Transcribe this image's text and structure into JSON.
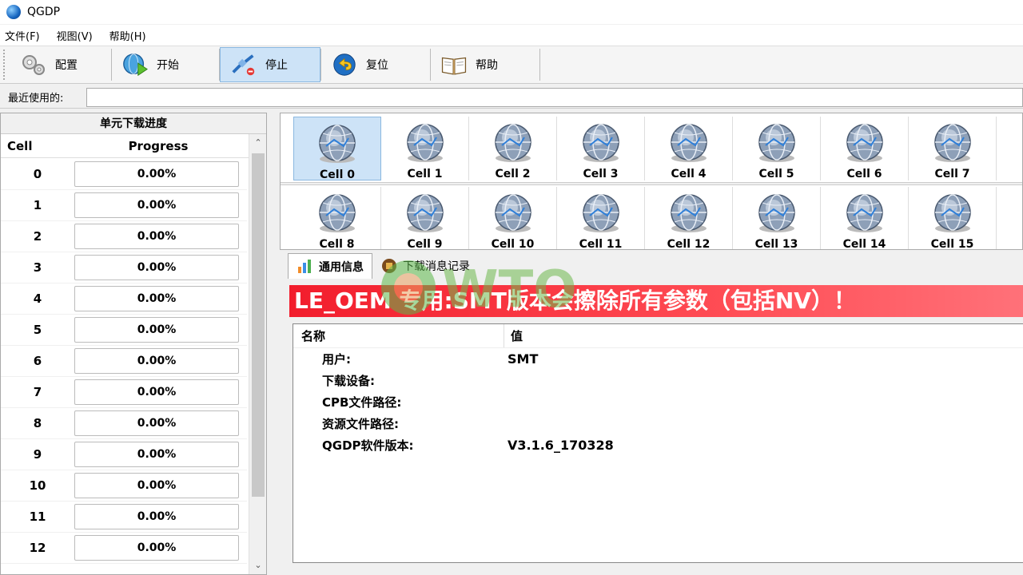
{
  "window": {
    "title": "QGDP"
  },
  "menu": {
    "items": [
      "文件(F)",
      "视图(V)",
      "帮助(H)"
    ]
  },
  "toolbar": {
    "config": "配置",
    "start": "开始",
    "stop": "停止",
    "reset": "复位",
    "help": "帮助"
  },
  "recent": {
    "label": "最近使用的:",
    "value": ""
  },
  "left_panel": {
    "title": "单元下载进度",
    "col_cell": "Cell",
    "col_progress": "Progress",
    "rows": [
      {
        "cell": "0",
        "progress": "0.00%"
      },
      {
        "cell": "1",
        "progress": "0.00%"
      },
      {
        "cell": "2",
        "progress": "0.00%"
      },
      {
        "cell": "3",
        "progress": "0.00%"
      },
      {
        "cell": "4",
        "progress": "0.00%"
      },
      {
        "cell": "5",
        "progress": "0.00%"
      },
      {
        "cell": "6",
        "progress": "0.00%"
      },
      {
        "cell": "7",
        "progress": "0.00%"
      },
      {
        "cell": "8",
        "progress": "0.00%"
      },
      {
        "cell": "9",
        "progress": "0.00%"
      },
      {
        "cell": "10",
        "progress": "0.00%"
      },
      {
        "cell": "11",
        "progress": "0.00%"
      },
      {
        "cell": "12",
        "progress": "0.00%"
      }
    ]
  },
  "cells": {
    "row1": [
      "Cell 0",
      "Cell 1",
      "Cell 2",
      "Cell 3",
      "Cell 4",
      "Cell 5",
      "Cell 6",
      "Cell 7"
    ],
    "row2": [
      "Cell 8",
      "Cell 9",
      "Cell 10",
      "Cell 11",
      "Cell 12",
      "Cell 13",
      "Cell 14",
      "Cell 15"
    ]
  },
  "tabs": {
    "general": "通用信息",
    "log": "下载消息记录"
  },
  "banner": {
    "text": "LE_OEM 专用:SMT版本会擦除所有参数（包括NV）！"
  },
  "info": {
    "col_name": "名称",
    "col_value": "值",
    "rows": [
      {
        "key": "用户:",
        "value": "SMT"
      },
      {
        "key": "下载设备:",
        "value": ""
      },
      {
        "key": "CPB文件路径:",
        "value": ""
      },
      {
        "key": "资源文件路径:",
        "value": ""
      },
      {
        "key": "QGDP软件版本:",
        "value": "V3.1.6_170328"
      }
    ]
  },
  "watermark": {
    "text": "WTO"
  },
  "colors": {
    "banner_red": "#f21d2c",
    "selected_blue": "#cde3f7"
  }
}
